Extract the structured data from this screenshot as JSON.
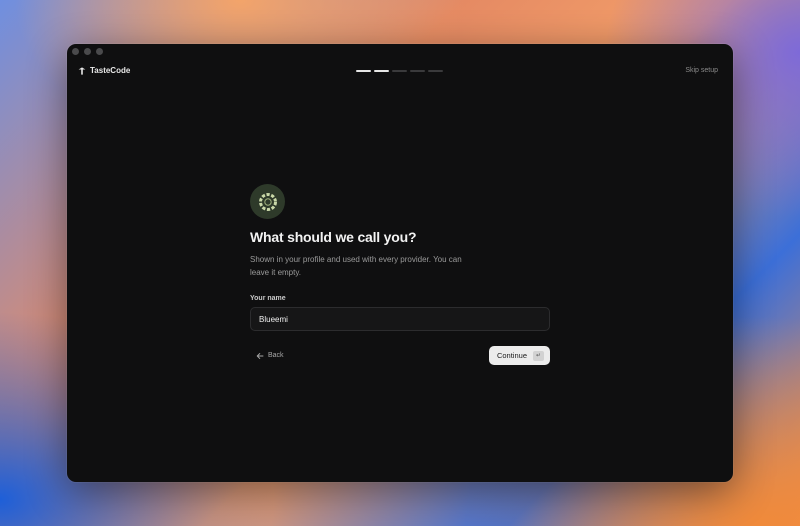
{
  "app": {
    "name": "TasteCode",
    "logo_icon": "tree-icon"
  },
  "header": {
    "skip_label": "Skip setup",
    "progress": {
      "total_steps": 5,
      "completed_steps": 2
    }
  },
  "step": {
    "avatar_icon": "sun-ring-icon",
    "title": "What should we call you?",
    "subtitle": "Shown in your profile and used with every provider. You can leave it empty.",
    "field_label": "Your name",
    "field_value": "Blueemi",
    "back_label": "Back",
    "continue_label": "Continue",
    "continue_shortcut": "↵"
  },
  "colors": {
    "window_bg": "#0f0f10",
    "progress_done": "#e6e6e6",
    "progress_pending": "#3a3a3c",
    "logo_bg": "#2e3a2a",
    "logo_accent": "#c9d8a8"
  }
}
